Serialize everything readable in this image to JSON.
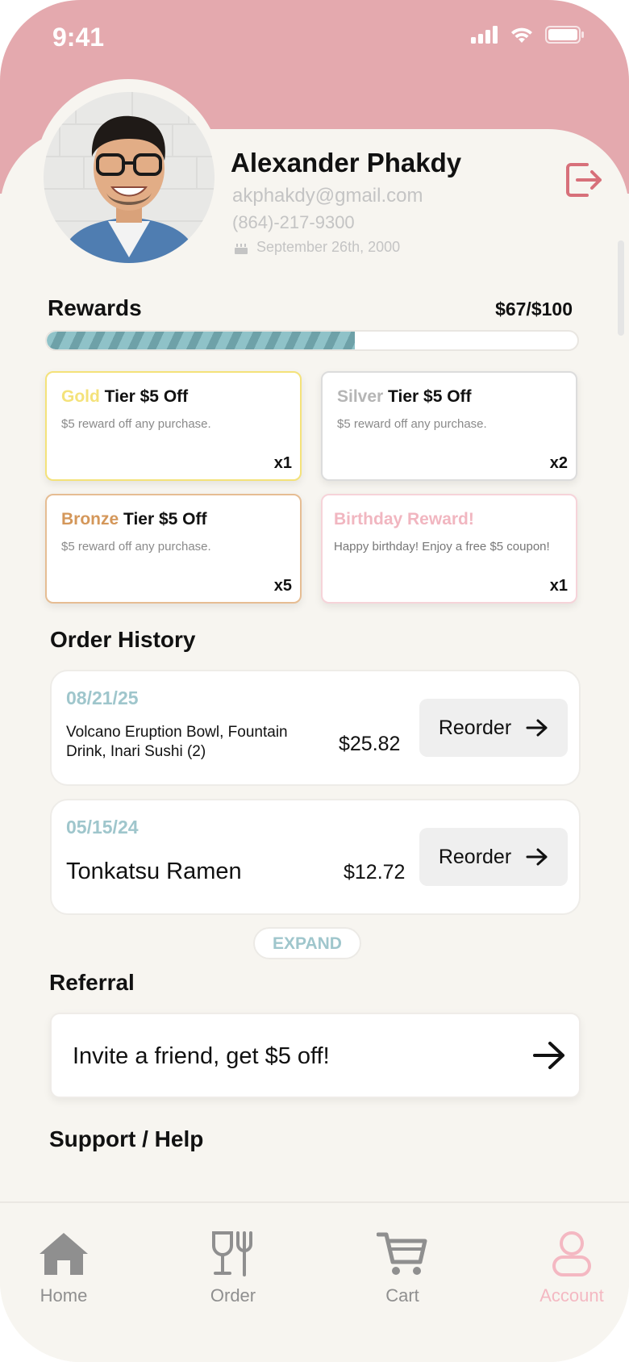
{
  "status_bar": {
    "time": "9:41"
  },
  "profile": {
    "name": "Alexander Phakdy",
    "email": "akphakdy@gmail.com",
    "phone": "(864)-217-9300",
    "birthday": "September 26th, 2000"
  },
  "rewards": {
    "title": "Rewards",
    "progress_text": "$67/$100",
    "progress_fraction": 0.58,
    "cards": [
      {
        "tier_word": "Gold",
        "tier_rest": " Tier $5 Off",
        "description": "$5 reward off any purchase.",
        "count": "x1",
        "accent": "#f4e27a"
      },
      {
        "tier_word": "Silver",
        "tier_rest": " Tier $5 Off",
        "description": "$5 reward off any purchase.",
        "count": "x2",
        "accent": "#b5b5b5"
      },
      {
        "tier_word": "Bronze",
        "tier_rest": " Tier $5 Off",
        "description": "$5 reward off any purchase.",
        "count": "x5",
        "accent": "#d4975a"
      },
      {
        "tier_word": "Birthday Reward!",
        "tier_rest": "",
        "description": "Happy birthday! Enjoy a free $5 coupon!",
        "count": "x1",
        "accent": "#f1b6c0"
      }
    ]
  },
  "order_history": {
    "title": "Order History",
    "orders": [
      {
        "date": "08/21/25",
        "items": "Volcano Eruption Bowl, Fountain Drink, Inari Sushi (2)",
        "price": "$25.82",
        "button": "Reorder"
      },
      {
        "date": "05/15/24",
        "items": "Tonkatsu Ramen",
        "price": "$12.72",
        "button": "Reorder"
      }
    ],
    "expand_label": "EXPAND"
  },
  "referral": {
    "title": "Referral",
    "text": "Invite a friend, get $5 off!"
  },
  "support": {
    "title": "Support / Help"
  },
  "nav": {
    "items": [
      {
        "label": "Home",
        "icon": "home-icon"
      },
      {
        "label": "Order",
        "icon": "fork-wine-icon"
      },
      {
        "label": "Cart",
        "icon": "cart-icon"
      },
      {
        "label": "Account",
        "icon": "account-icon"
      }
    ],
    "active": "Account",
    "active_color": "#f4b8c2",
    "inactive_color": "#8f8f8f"
  },
  "colors": {
    "header_pink": "#e4a9ae",
    "accent_teal": "#9fc6cc",
    "background": "#f7f5f0"
  }
}
